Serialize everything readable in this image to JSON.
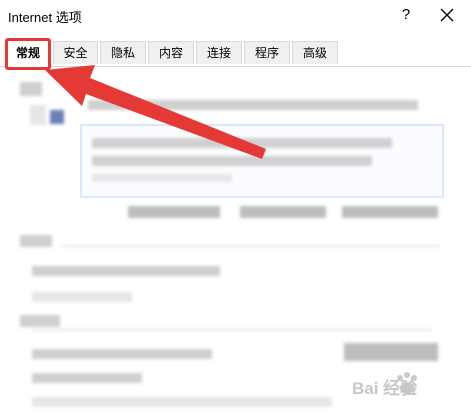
{
  "window": {
    "title": "Internet 选项",
    "help_label": "?",
    "close_icon": "close-icon"
  },
  "tabs": [
    {
      "label": "常规",
      "active": true
    },
    {
      "label": "安全",
      "active": false
    },
    {
      "label": "隐私",
      "active": false
    },
    {
      "label": "内容",
      "active": false
    },
    {
      "label": "连接",
      "active": false
    },
    {
      "label": "程序",
      "active": false
    },
    {
      "label": "高级",
      "active": false
    }
  ],
  "annotation": {
    "highlight_color": "#e53935",
    "arrow_color": "#e53935"
  },
  "watermark": {
    "text": "Bai 经验"
  }
}
